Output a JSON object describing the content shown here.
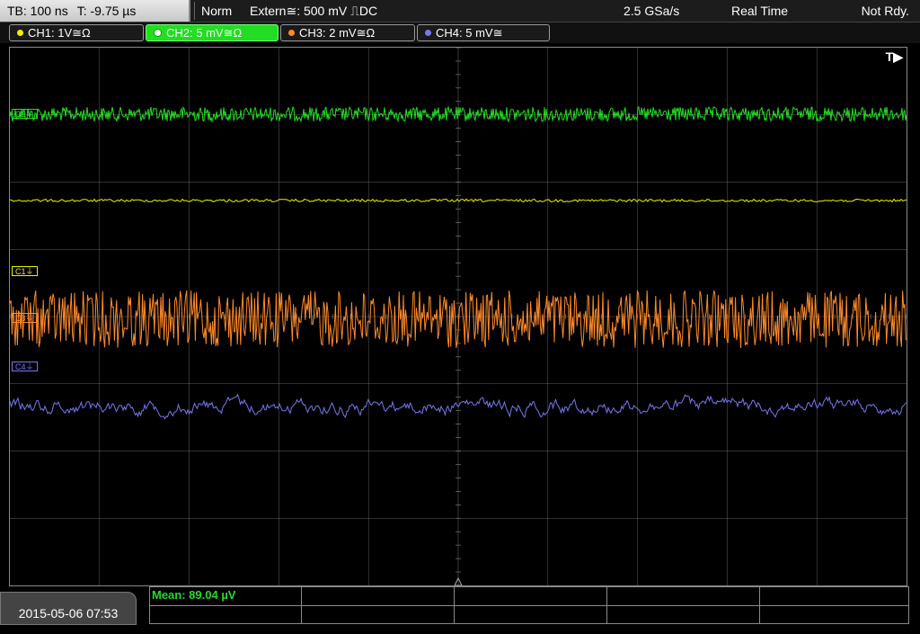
{
  "topbar": {
    "timebase": "TB: 100 ns",
    "trigger_offset": "T: -9.75 µs",
    "trigger_mode": "Norm",
    "trigger_source": "Extern≅: 500 mV ⎍DC",
    "sample_rate": "2.5 GSa/s",
    "acquisition_mode": "Real Time",
    "status": "Not Rdy."
  },
  "channels": [
    {
      "id": "ch1",
      "label": "CH1: 1V≅Ω",
      "color": "#f0f000",
      "marker": "C1⏚"
    },
    {
      "id": "ch2",
      "label": "CH2: 5 mV≅Ω",
      "color": "#22dd22",
      "marker": "C2⏚"
    },
    {
      "id": "ch3",
      "label": "CH3: 2 mV≅Ω",
      "color": "#ff8a2a",
      "marker": "C3⏚"
    },
    {
      "id": "ch4",
      "label": "CH4: 5 mV≅",
      "color": "#7777ee",
      "marker": "C4⏚"
    }
  ],
  "trigger_marker": "T▶",
  "measurement": {
    "label": "Mean: 89.04 µV"
  },
  "datetime": "2015-05-06 07:53",
  "colors": {
    "grid": "#8a8a8a",
    "ch1": "#f0f000",
    "ch2": "#22dd22",
    "ch3": "#ff8a2a",
    "ch4": "#7777ee"
  }
}
